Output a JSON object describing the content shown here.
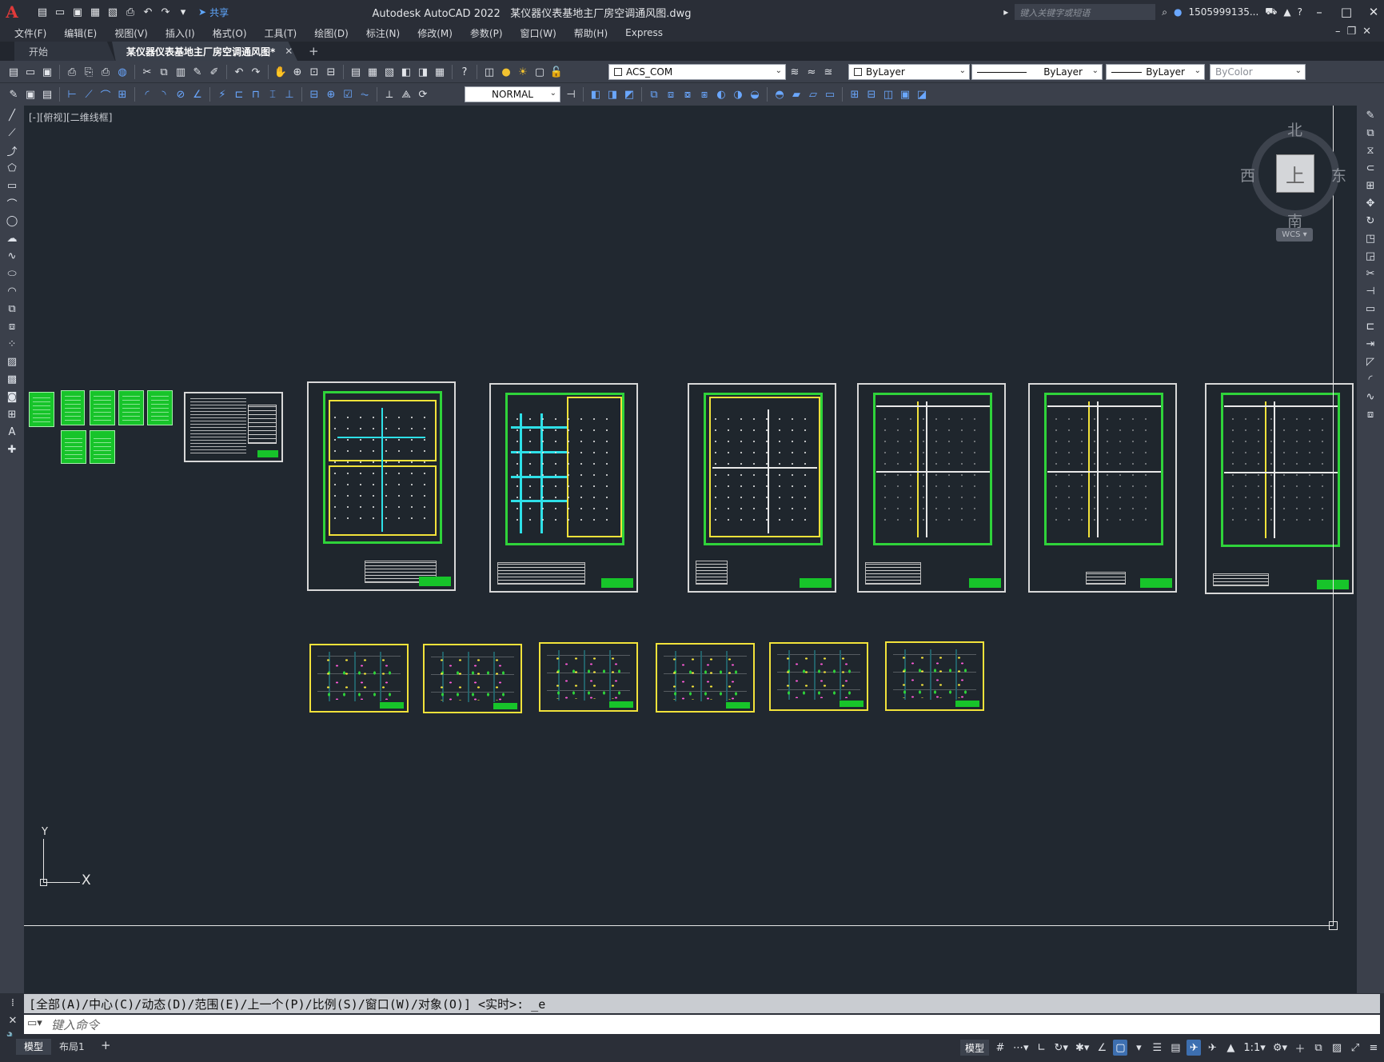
{
  "titlebar": {
    "app_name": "Autodesk AutoCAD 2022",
    "file_name": "某仪器仪表基地主厂房空调通风图.dwg",
    "share_label": "共享",
    "search_placeholder": "键入关键字或短语",
    "user": "1505999135...",
    "logo": "A"
  },
  "menu": [
    "文件(F)",
    "编辑(E)",
    "视图(V)",
    "插入(I)",
    "格式(O)",
    "工具(T)",
    "绘图(D)",
    "标注(N)",
    "修改(M)",
    "参数(P)",
    "窗口(W)",
    "帮助(H)",
    "Express"
  ],
  "tabs": {
    "start": "开始",
    "active": "某仪器仪表基地主厂房空调通风图*"
  },
  "toolbar": {
    "ucs_name": "ACS_COM",
    "layer_color": "ByLayer",
    "linetype": "ByLayer",
    "lineweight": "ByLayer",
    "plotstyle": "ByColor",
    "dimstyle": "NORMAL"
  },
  "viewport": {
    "label": "[-][俯视][二维线框]"
  },
  "viewcube": {
    "north": "北",
    "south": "南",
    "west": "西",
    "east": "东",
    "top": "上",
    "wcs": "WCS"
  },
  "ucs": {
    "x": "X",
    "y": "Y"
  },
  "command": {
    "history": "[全部(A)/中心(C)/动态(D)/范围(E)/上一个(P)/比例(S)/窗口(W)/对象(O)] <实时>: _e",
    "placeholder": "键入命令"
  },
  "status": {
    "model_tab": "模型",
    "layout_tab": "布局1",
    "model_btn": "模型",
    "scale": "1:1"
  },
  "colors": {
    "canvas": "#212830",
    "panel": "#3b404b",
    "green": "#17c42a",
    "yellow": "#f2e23a",
    "cyan": "#2ee0e8"
  }
}
